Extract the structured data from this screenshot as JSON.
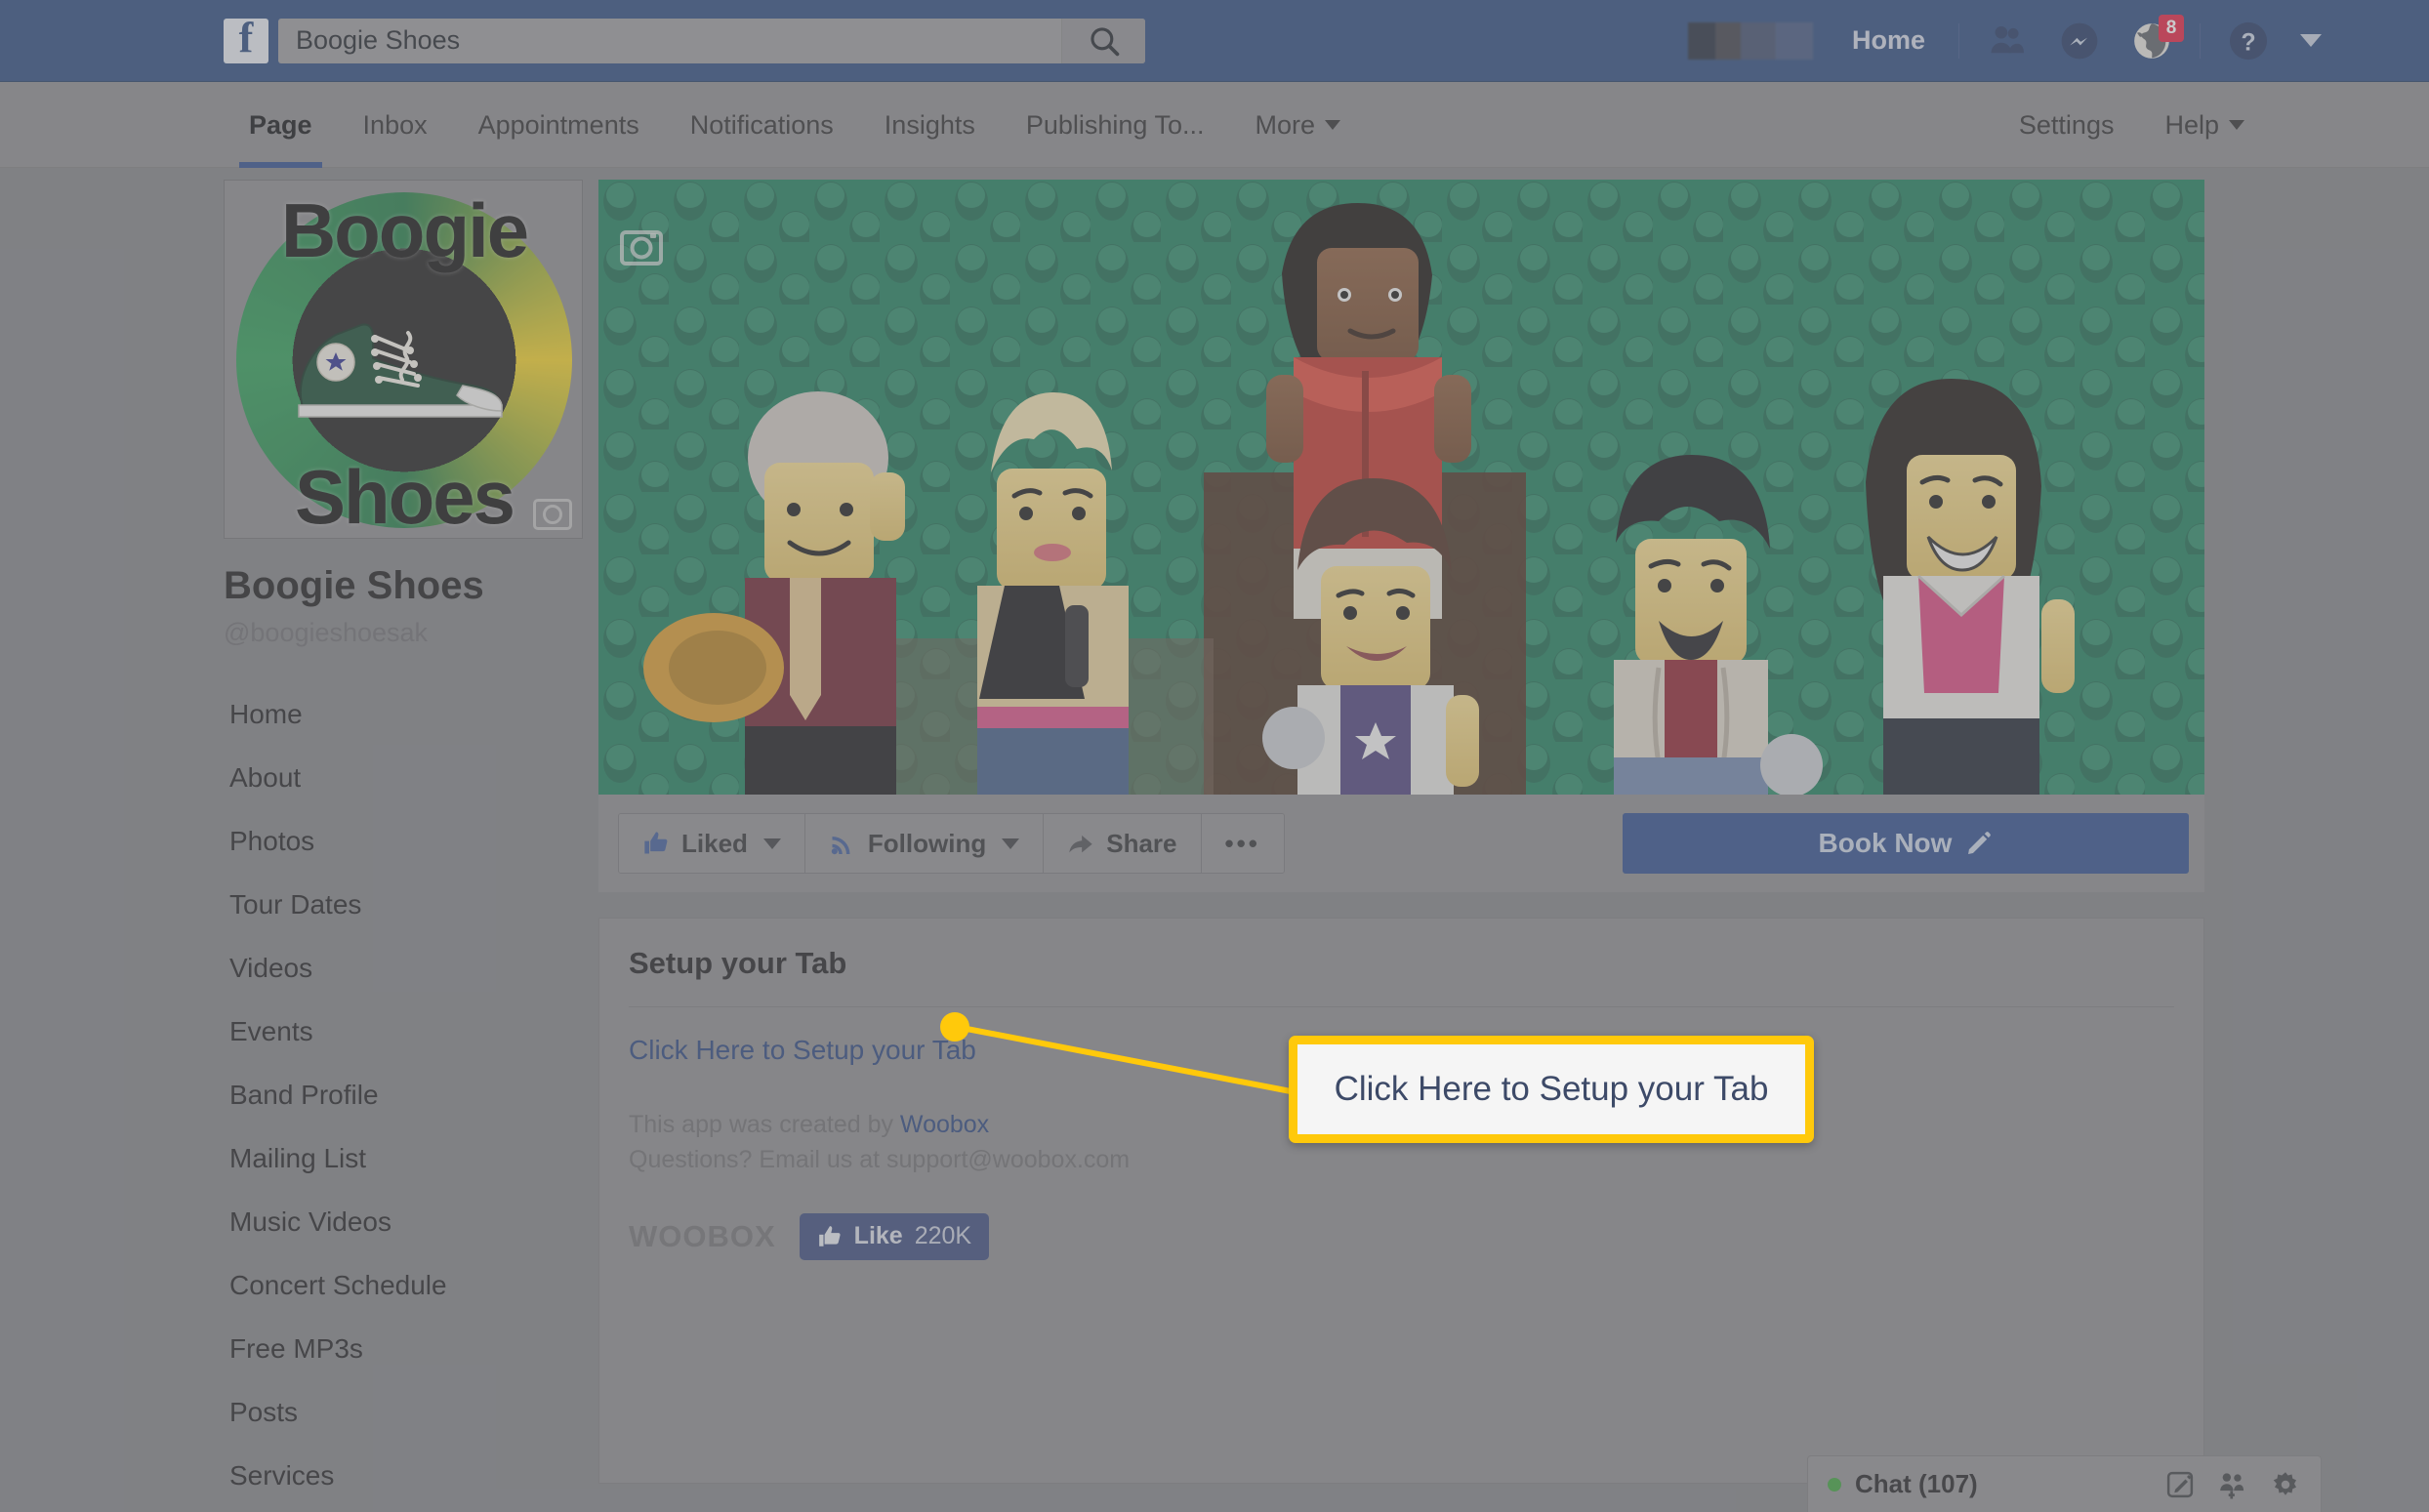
{
  "topbar": {
    "logo_icon": "facebook-f-logo",
    "search_value": "Boogie Shoes",
    "search_placeholder": "Search",
    "search_icon": "search-icon",
    "home_label": "Home",
    "icons": [
      {
        "name": "friend-requests-icon",
        "glyph": "friends"
      },
      {
        "name": "messenger-icon",
        "glyph": "messenger"
      },
      {
        "name": "notifications-globe-icon",
        "glyph": "globe",
        "badge": "8"
      },
      {
        "name": "help-question-icon",
        "glyph": "question"
      }
    ],
    "account_caret_icon": "chevron-down-icon"
  },
  "nav": {
    "tabs": [
      {
        "label": "Page",
        "active": true
      },
      {
        "label": "Inbox",
        "active": false
      },
      {
        "label": "Appointments",
        "active": false
      },
      {
        "label": "Notifications",
        "active": false
      },
      {
        "label": "Insights",
        "active": false
      },
      {
        "label": "Publishing To...",
        "active": false
      },
      {
        "label": "More",
        "active": false,
        "caret": true
      }
    ],
    "right": [
      {
        "label": "Settings",
        "caret": false
      },
      {
        "label": "Help",
        "caret": true
      }
    ]
  },
  "sidebar": {
    "logo_alt": "Boogie Shoes logo",
    "logo_text_top": "Boogie",
    "logo_text_bottom": "Shoes",
    "page_name": "Boogie Shoes",
    "page_handle": "@boogieshoesak",
    "items": [
      {
        "label": "Home"
      },
      {
        "label": "About"
      },
      {
        "label": "Photos"
      },
      {
        "label": "Tour Dates"
      },
      {
        "label": "Videos"
      },
      {
        "label": "Events"
      },
      {
        "label": "Band Profile"
      },
      {
        "label": "Mailing List"
      },
      {
        "label": "Music Videos"
      },
      {
        "label": "Concert Schedule"
      },
      {
        "label": "Free MP3s"
      },
      {
        "label": "Posts"
      },
      {
        "label": "Services"
      }
    ]
  },
  "cover": {
    "camera_icon": "camera-icon",
    "description": "LEGO minifigures band photo on green baseplate"
  },
  "actions": {
    "liked_label": "Liked",
    "liked_icon": "thumbs-up-icon",
    "following_label": "Following",
    "following_icon": "rss-icon",
    "share_label": "Share",
    "share_icon": "share-arrow-icon",
    "more_label": "•••",
    "more_icon": "ellipsis-icon",
    "book_now_label": "Book Now",
    "book_now_icon": "pencil-icon"
  },
  "tab_card": {
    "title": "Setup your Tab",
    "setup_link": "Click Here to Setup your Tab",
    "credit_line1_prefix": "This app was created by ",
    "credit_line1_link": "Woobox",
    "credit_line2": "Questions? Email us at support@woobox.com",
    "woobox_logo": "WOOBOX",
    "like_label": "Like",
    "like_count": "220K",
    "like_icon": "thumbs-up-icon"
  },
  "chat": {
    "label": "Chat (107)",
    "status_color": "#3aa03a",
    "icons": [
      {
        "name": "compose-message-icon"
      },
      {
        "name": "add-friend-group-icon"
      },
      {
        "name": "chat-settings-gear-icon"
      }
    ]
  },
  "annotation": {
    "callout_text": "Click Here to Setup your Tab",
    "accent_color": "#ffc90b"
  },
  "colors": {
    "facebook_blue": "#29487d",
    "accent_yellow": "#ffc90b",
    "link_blue": "#27427c",
    "button_blue": "#2b4b8c"
  }
}
